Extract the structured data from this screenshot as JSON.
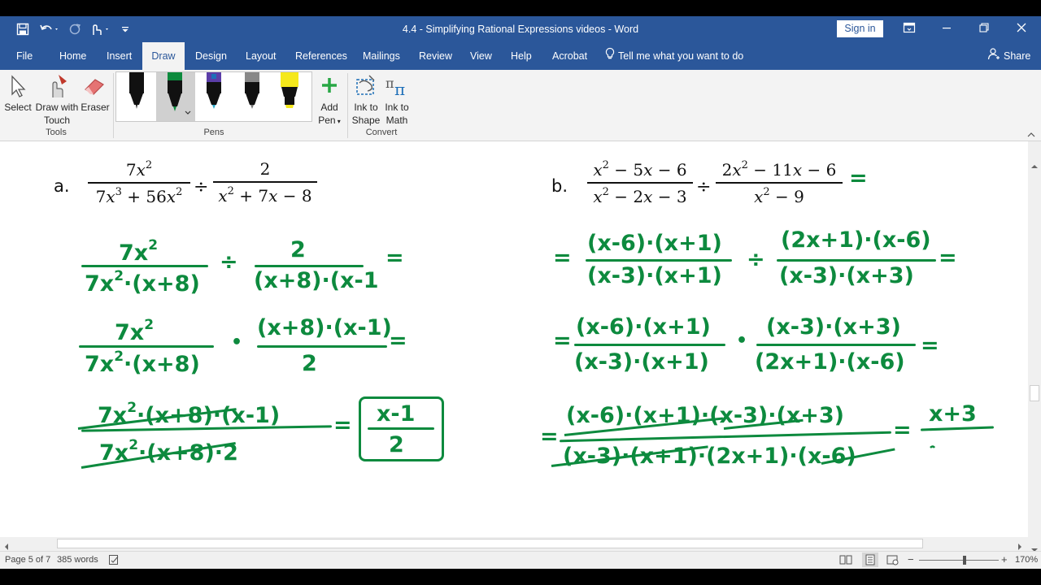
{
  "titlebar": {
    "doc_title": "4.4 - Simplifying Rational Expressions videos  -  Word",
    "sign_in": "Sign in"
  },
  "tabs": [
    "File",
    "Home",
    "Insert",
    "Draw",
    "Design",
    "Layout",
    "References",
    "Mailings",
    "Review",
    "View",
    "Help",
    "Acrobat"
  ],
  "active_tab": "Draw",
  "tell_me": "Tell me what you want to do",
  "share": "Share",
  "ribbon": {
    "select": "Select",
    "draw_touch_1": "Draw with",
    "draw_touch_2": "Touch",
    "eraser": "Eraser",
    "tools_group": "Tools",
    "pens_group": "Pens",
    "add_pen_1": "Add",
    "add_pen_2": "Pen",
    "ink_shape_1": "Ink to",
    "ink_shape_2": "Shape",
    "ink_math_1": "Ink to",
    "ink_math_2": "Math",
    "convert_group": "Convert"
  },
  "pens": [
    {
      "color": "#111111",
      "kind": "pen"
    },
    {
      "color": "#0d8a3e",
      "kind": "pen"
    },
    {
      "color": "#1e6fb8",
      "kind": "galaxy"
    },
    {
      "color": "#888888",
      "kind": "pencil"
    },
    {
      "color": "#f5e81b",
      "kind": "highlighter"
    }
  ],
  "status": {
    "page": "Page 5 of 7",
    "words": "385 words",
    "zoom": "170%"
  },
  "problem_a": {
    "label": "a.",
    "num1": "7x²",
    "den1": "7x³ + 56x²",
    "op": "÷",
    "num2": "2",
    "den2": "x² + 7x − 8"
  },
  "problem_b": {
    "label": "b.",
    "num1": "x² − 5x − 6",
    "den1": "x² − 2x − 3",
    "op": "÷",
    "num2": "2x² − 11x − 6",
    "den2": "x² − 9"
  },
  "handwriting": {
    "a_step1": {
      "num1": "7x",
      "den1": "7x",
      "den1b": "·(x+8)",
      "op": "÷",
      "num2": "2",
      "den2": "(x+8)·(x-1"
    },
    "a_step2": {
      "num1": "7x",
      "den1": "7x",
      "den1b": "·(x+8)",
      "num2": "(x+8)·(x-1)",
      "den2": "2"
    },
    "a_step3": {
      "num": "7x",
      "num_b": "·(x+8)·(x-1)",
      "den": "7x",
      "den_b": "·(x+8)·2"
    },
    "a_answer": {
      "num": "x-1",
      "den": "2"
    },
    "b_step1": {
      "num1": "(x-6)·(x+1)",
      "den1": "(x-3)·(x+1)",
      "num2": "(2x+1)·(x-6)",
      "den2": "(x-3)·(x+3)"
    },
    "b_step2": {
      "num1": "(x-6)·(x+1)",
      "den1": "(x-3)·(x+1)",
      "num2": "(x-3)·(x+3)",
      "den2": "(2x+1)·(x-6)"
    },
    "b_step3": {
      "num": "(x-6)·(x+1)·(x-3)·(x+3)",
      "den": "(x-3)·(x+1)·(2x+1)·(x-6)"
    },
    "b_result": {
      "num": "x+3"
    },
    "sup2": "2",
    "eq": "=",
    "dot": "•"
  }
}
